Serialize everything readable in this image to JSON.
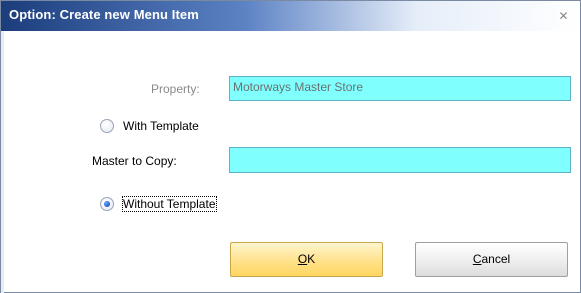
{
  "window": {
    "title": "Option: Create new Menu Item",
    "close_glyph": "✕"
  },
  "form": {
    "property_label": "Property:",
    "property_value": "Motorways Master Store",
    "with_template_label": "With Template",
    "with_template_checked": false,
    "master_to_copy_label": "Master to Copy:",
    "master_to_copy_value": "",
    "without_template_label": "Without Template",
    "without_template_checked": true
  },
  "buttons": {
    "ok_mnemonic": "O",
    "ok_rest": "K",
    "cancel_mnemonic": "C",
    "cancel_rest": "ancel"
  },
  "colors": {
    "field_background": "#80ffff",
    "ok_button": "#ffe18a",
    "title_bar": "#1b3d7c"
  },
  "icons": {
    "close": "close-icon"
  }
}
